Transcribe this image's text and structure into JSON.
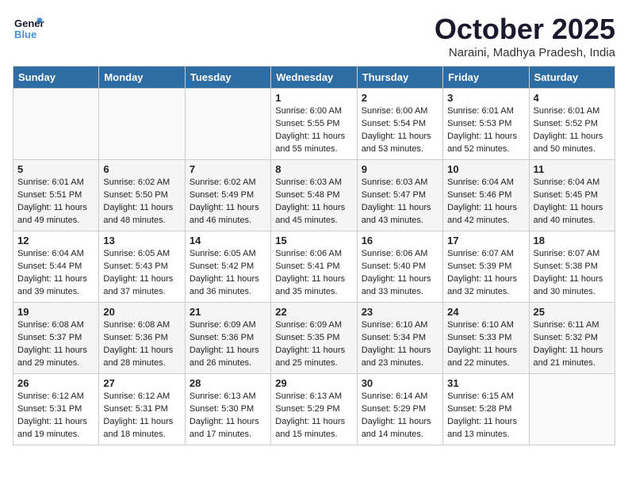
{
  "header": {
    "logo_general": "General",
    "logo_blue": "Blue",
    "month_title": "October 2025",
    "location": "Naraini, Madhya Pradesh, India"
  },
  "weekdays": [
    "Sunday",
    "Monday",
    "Tuesday",
    "Wednesday",
    "Thursday",
    "Friday",
    "Saturday"
  ],
  "weeks": [
    [
      {
        "day": "",
        "info": ""
      },
      {
        "day": "",
        "info": ""
      },
      {
        "day": "",
        "info": ""
      },
      {
        "day": "1",
        "info": "Sunrise: 6:00 AM\nSunset: 5:55 PM\nDaylight: 11 hours\nand 55 minutes."
      },
      {
        "day": "2",
        "info": "Sunrise: 6:00 AM\nSunset: 5:54 PM\nDaylight: 11 hours\nand 53 minutes."
      },
      {
        "day": "3",
        "info": "Sunrise: 6:01 AM\nSunset: 5:53 PM\nDaylight: 11 hours\nand 52 minutes."
      },
      {
        "day": "4",
        "info": "Sunrise: 6:01 AM\nSunset: 5:52 PM\nDaylight: 11 hours\nand 50 minutes."
      }
    ],
    [
      {
        "day": "5",
        "info": "Sunrise: 6:01 AM\nSunset: 5:51 PM\nDaylight: 11 hours\nand 49 minutes."
      },
      {
        "day": "6",
        "info": "Sunrise: 6:02 AM\nSunset: 5:50 PM\nDaylight: 11 hours\nand 48 minutes."
      },
      {
        "day": "7",
        "info": "Sunrise: 6:02 AM\nSunset: 5:49 PM\nDaylight: 11 hours\nand 46 minutes."
      },
      {
        "day": "8",
        "info": "Sunrise: 6:03 AM\nSunset: 5:48 PM\nDaylight: 11 hours\nand 45 minutes."
      },
      {
        "day": "9",
        "info": "Sunrise: 6:03 AM\nSunset: 5:47 PM\nDaylight: 11 hours\nand 43 minutes."
      },
      {
        "day": "10",
        "info": "Sunrise: 6:04 AM\nSunset: 5:46 PM\nDaylight: 11 hours\nand 42 minutes."
      },
      {
        "day": "11",
        "info": "Sunrise: 6:04 AM\nSunset: 5:45 PM\nDaylight: 11 hours\nand 40 minutes."
      }
    ],
    [
      {
        "day": "12",
        "info": "Sunrise: 6:04 AM\nSunset: 5:44 PM\nDaylight: 11 hours\nand 39 minutes."
      },
      {
        "day": "13",
        "info": "Sunrise: 6:05 AM\nSunset: 5:43 PM\nDaylight: 11 hours\nand 37 minutes."
      },
      {
        "day": "14",
        "info": "Sunrise: 6:05 AM\nSunset: 5:42 PM\nDaylight: 11 hours\nand 36 minutes."
      },
      {
        "day": "15",
        "info": "Sunrise: 6:06 AM\nSunset: 5:41 PM\nDaylight: 11 hours\nand 35 minutes."
      },
      {
        "day": "16",
        "info": "Sunrise: 6:06 AM\nSunset: 5:40 PM\nDaylight: 11 hours\nand 33 minutes."
      },
      {
        "day": "17",
        "info": "Sunrise: 6:07 AM\nSunset: 5:39 PM\nDaylight: 11 hours\nand 32 minutes."
      },
      {
        "day": "18",
        "info": "Sunrise: 6:07 AM\nSunset: 5:38 PM\nDaylight: 11 hours\nand 30 minutes."
      }
    ],
    [
      {
        "day": "19",
        "info": "Sunrise: 6:08 AM\nSunset: 5:37 PM\nDaylight: 11 hours\nand 29 minutes."
      },
      {
        "day": "20",
        "info": "Sunrise: 6:08 AM\nSunset: 5:36 PM\nDaylight: 11 hours\nand 28 minutes."
      },
      {
        "day": "21",
        "info": "Sunrise: 6:09 AM\nSunset: 5:36 PM\nDaylight: 11 hours\nand 26 minutes."
      },
      {
        "day": "22",
        "info": "Sunrise: 6:09 AM\nSunset: 5:35 PM\nDaylight: 11 hours\nand 25 minutes."
      },
      {
        "day": "23",
        "info": "Sunrise: 6:10 AM\nSunset: 5:34 PM\nDaylight: 11 hours\nand 23 minutes."
      },
      {
        "day": "24",
        "info": "Sunrise: 6:10 AM\nSunset: 5:33 PM\nDaylight: 11 hours\nand 22 minutes."
      },
      {
        "day": "25",
        "info": "Sunrise: 6:11 AM\nSunset: 5:32 PM\nDaylight: 11 hours\nand 21 minutes."
      }
    ],
    [
      {
        "day": "26",
        "info": "Sunrise: 6:12 AM\nSunset: 5:31 PM\nDaylight: 11 hours\nand 19 minutes."
      },
      {
        "day": "27",
        "info": "Sunrise: 6:12 AM\nSunset: 5:31 PM\nDaylight: 11 hours\nand 18 minutes."
      },
      {
        "day": "28",
        "info": "Sunrise: 6:13 AM\nSunset: 5:30 PM\nDaylight: 11 hours\nand 17 minutes."
      },
      {
        "day": "29",
        "info": "Sunrise: 6:13 AM\nSunset: 5:29 PM\nDaylight: 11 hours\nand 15 minutes."
      },
      {
        "day": "30",
        "info": "Sunrise: 6:14 AM\nSunset: 5:29 PM\nDaylight: 11 hours\nand 14 minutes."
      },
      {
        "day": "31",
        "info": "Sunrise: 6:15 AM\nSunset: 5:28 PM\nDaylight: 11 hours\nand 13 minutes."
      },
      {
        "day": "",
        "info": ""
      }
    ]
  ]
}
